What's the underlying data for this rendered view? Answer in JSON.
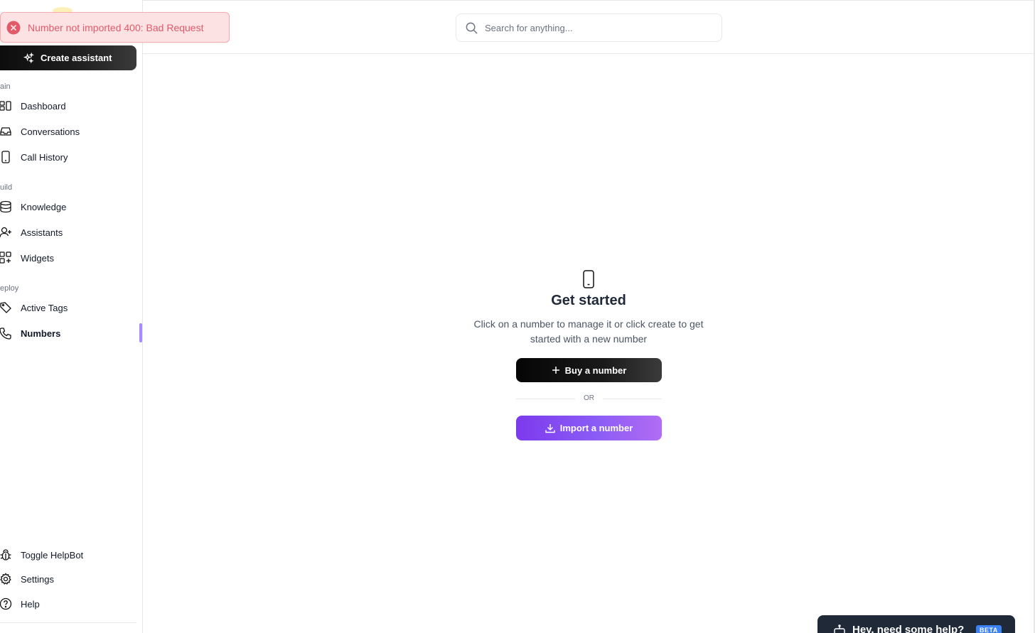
{
  "toast": {
    "message": "Number not imported 400: Bad Request",
    "color": "#e05a6a"
  },
  "sidebar": {
    "create_button": "Create assistant",
    "sections": {
      "main": "ain",
      "build": "uild",
      "deploy": "eploy"
    },
    "items": [
      {
        "label": "Dashboard",
        "icon": "dashboard-icon"
      },
      {
        "label": "Conversations",
        "icon": "inbox-icon"
      },
      {
        "label": "Call History",
        "icon": "phone-device-icon"
      },
      {
        "label": "Knowledge",
        "icon": "database-icon"
      },
      {
        "label": "Assistants",
        "icon": "user-plus-icon"
      },
      {
        "label": "Widgets",
        "icon": "grid-plus-icon"
      },
      {
        "label": "Active Tags",
        "icon": "tag-icon"
      },
      {
        "label": "Numbers",
        "icon": "phone-icon"
      }
    ],
    "bottom": [
      {
        "label": "Toggle HelpBot",
        "icon": "bug-icon"
      },
      {
        "label": "Settings",
        "icon": "gear-icon"
      },
      {
        "label": "Help",
        "icon": "help-circle-icon"
      }
    ],
    "active_item": "Numbers",
    "accent": "#a78bfa"
  },
  "header": {
    "search_placeholder": "Search for anything..."
  },
  "empty_state": {
    "title": "Get started",
    "description": "Click on a number to manage it or click create to get started with a new number",
    "buy_button": "Buy a number",
    "or_text": "OR",
    "import_button": "Import a number"
  },
  "help_widget": {
    "label": "Hey, need some help?",
    "badge": "BETA"
  },
  "colors": {
    "primary_purple": "#8b5cf6",
    "dark_button": "#111111"
  }
}
